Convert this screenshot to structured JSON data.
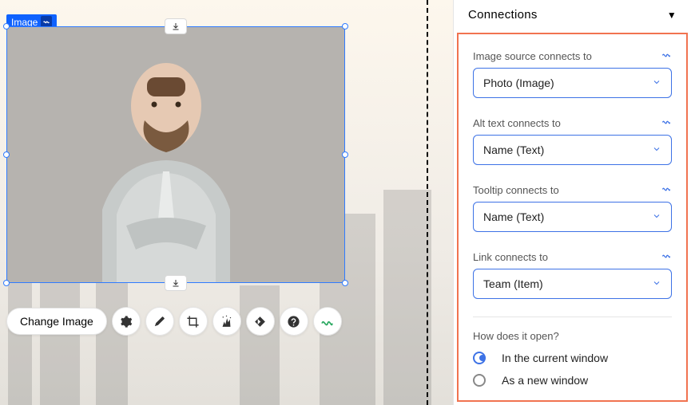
{
  "element": {
    "label": "Image"
  },
  "toolbar": {
    "change_image": "Change Image"
  },
  "panel": {
    "title": "Connections",
    "fields": [
      {
        "label": "Image source connects to",
        "value": "Photo (Image)"
      },
      {
        "label": "Alt text connects to",
        "value": "Name (Text)"
      },
      {
        "label": "Tooltip connects to",
        "value": "Name (Text)"
      },
      {
        "label": "Link connects to",
        "value": "Team (Item)"
      }
    ],
    "open": {
      "question": "How does it open?",
      "options": [
        {
          "label": "In the current window",
          "selected": true
        },
        {
          "label": "As a new window",
          "selected": false
        }
      ]
    }
  }
}
